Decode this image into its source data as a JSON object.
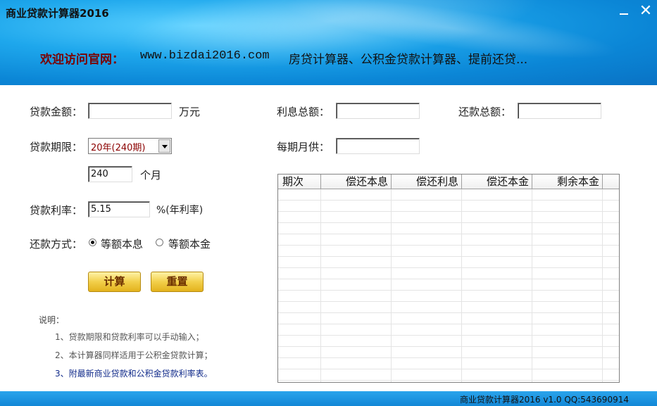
{
  "window": {
    "title": "商业贷款计算器2016",
    "minimize_glyph": "",
    "close_glyph": "✕"
  },
  "banner": {
    "welcome": "欢迎访问官网：",
    "url": "www.bizdai2016.com",
    "links": "房贷计算器、公积金贷款计算器、提前还贷..."
  },
  "form": {
    "loan_amount_label": "贷款金额：",
    "loan_amount_value": "",
    "loan_amount_unit": "万元",
    "term_label": "贷款期限：",
    "term_selected": "20年(240期)",
    "months_value": "240",
    "months_unit": "个月",
    "rate_label": "贷款利率：",
    "rate_value": "5.15",
    "rate_unit": "%(年利率)",
    "method_label": "还款方式：",
    "method_option_1": "等额本息",
    "method_option_2": "等额本金",
    "method_selected": "等额本息"
  },
  "results": {
    "total_interest_label": "利息总额：",
    "total_interest_value": "",
    "total_repay_label": "还款总额：",
    "total_repay_value": "",
    "monthly_label": "每期月供：",
    "monthly_value": ""
  },
  "buttons": {
    "calculate": "计算",
    "reset": "重置"
  },
  "notes": {
    "title": "说明：",
    "items": [
      "1、贷款期限和贷款利率可以手动输入；",
      "2、本计算器同样适用于公积金贷款计算；",
      "3、附最新商业贷款和公积金贷款利率表。"
    ]
  },
  "table": {
    "columns": [
      "期次",
      "偿还本息",
      "偿还利息",
      "偿还本金",
      "剩余本金"
    ],
    "rows": []
  },
  "statusbar": {
    "text": "商业贷款计算器2016 v1.0 QQ:543690914"
  },
  "colors": {
    "header_blue": "#1ea7ec",
    "status_blue": "#1287d6",
    "button_gold": "#f2cf4a",
    "welcome_red": "#7a0000"
  }
}
